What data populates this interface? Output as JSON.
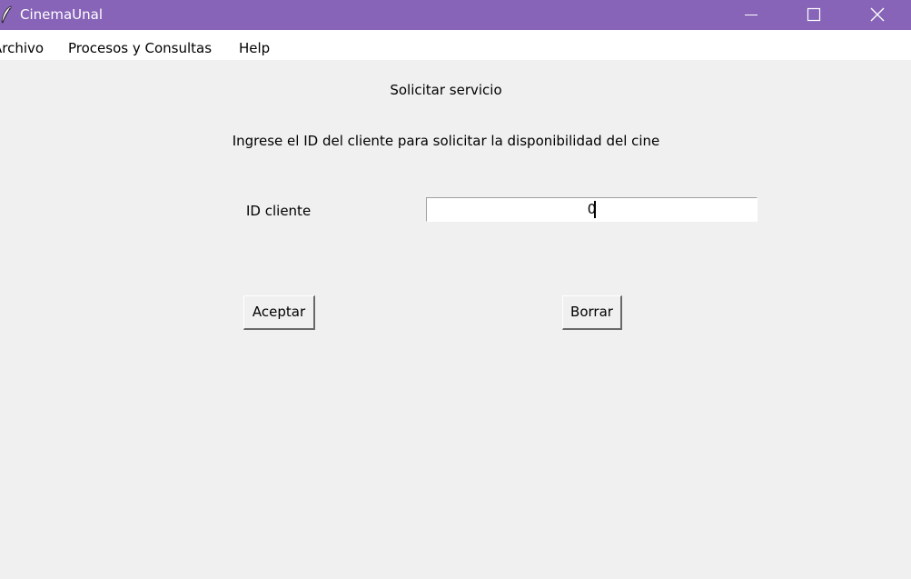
{
  "window": {
    "title": "CinemaUnal",
    "titlebar_color": "#8764b8",
    "icons": [
      "feather-icon",
      "minimize-icon",
      "maximize-icon",
      "close-icon"
    ]
  },
  "menu": {
    "items": [
      {
        "label": "Archivo"
      },
      {
        "label": "Procesos y Consultas"
      },
      {
        "label": "Help"
      }
    ]
  },
  "form": {
    "heading": "Solicitar servicio",
    "instructions": "Ingrese el ID del cliente para solicitar la disponibilidad del cine",
    "id_label": "ID cliente",
    "id_value": "0",
    "accept_label": "Aceptar",
    "clear_label": "Borrar"
  }
}
